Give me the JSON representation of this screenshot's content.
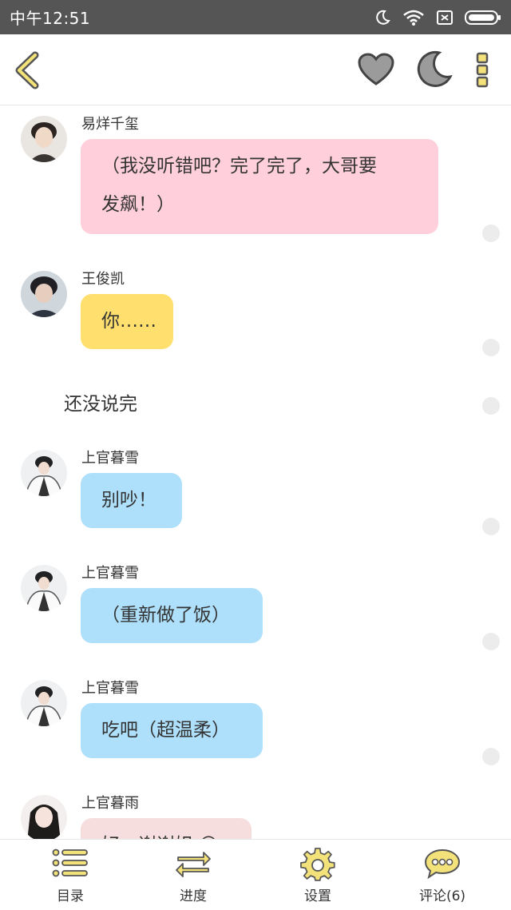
{
  "status_bar": {
    "time": "中午12:51"
  },
  "messages": [
    {
      "sender": "易烊千玺",
      "text_line1": "（我没听错吧？完了完了，大哥要",
      "text_line2": "发飙！）"
    },
    {
      "sender": "王俊凯",
      "text": "你……"
    },
    {
      "narration": "还没说完"
    },
    {
      "sender": "上官暮雪",
      "text": "别吵！"
    },
    {
      "sender": "上官暮雪",
      "text": "（重新做了饭）"
    },
    {
      "sender": "上官暮雪",
      "text": "吃吧（超温柔）"
    },
    {
      "sender": "上官暮雨",
      "text": "好，谢谢姐 😊"
    }
  ],
  "bottom_nav": [
    {
      "label": "目录"
    },
    {
      "label": "进度"
    },
    {
      "label": "设置"
    },
    {
      "label": "评论(6)"
    }
  ],
  "colors": {
    "accent": "#f3e27a",
    "bubble_pink": "#ffd0dc",
    "bubble_yellow": "#ffdf6e",
    "bubble_blue": "#aee0fb"
  }
}
